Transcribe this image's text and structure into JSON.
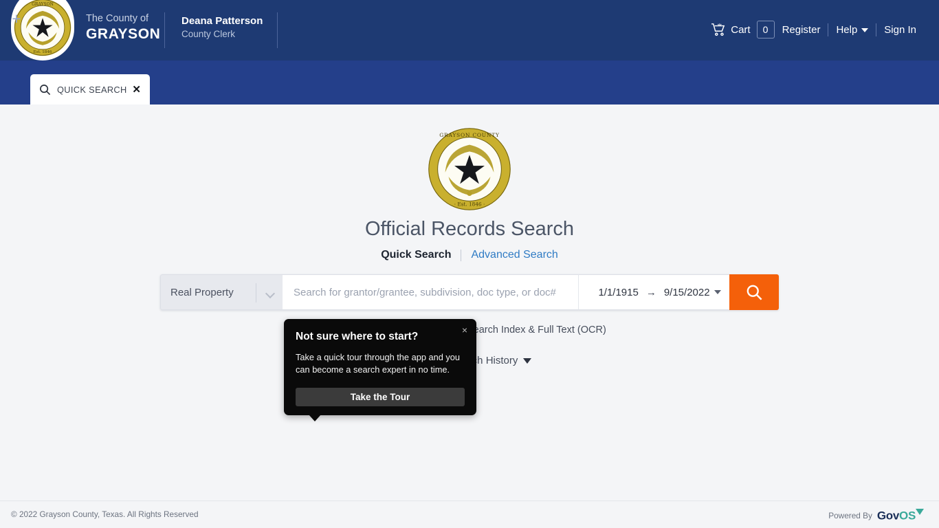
{
  "header": {
    "county_prefix": "The County of",
    "county_name": "GRAYSON",
    "clerk_name": "Deana Patterson",
    "clerk_title": "County Clerk",
    "nav": {
      "cart_label": "Cart",
      "cart_count": "0",
      "register_label": "Register",
      "help_label": "Help",
      "signin_label": "Sign In"
    },
    "colors": {
      "header_bg": "#1e3a73",
      "tabbar_bg": "#243f8a"
    }
  },
  "tabbar": {
    "add_tab_label": "+",
    "tabs": [
      {
        "label": "QUICK SEARCH",
        "icon": "search-icon",
        "close": "✕"
      }
    ]
  },
  "main": {
    "seal_alt": "Grayson County Texas Est. 1846",
    "title": "Official Records Search",
    "modes": {
      "quick_label": "Quick Search",
      "advanced_label": "Advanced Search"
    },
    "search": {
      "category_value": "Real Property",
      "query_value": "",
      "query_placeholder": "Search for grantor/grantee, subdivision, doc type, or doc#",
      "date_from": "1/1/1915",
      "date_to": "9/15/2022",
      "range_arrow": "→",
      "submit_icon": "search-icon",
      "submit_color": "#f4600a"
    },
    "options": {
      "ocr_label": "Search Index & Full Text (OCR)",
      "ocr_checked": false,
      "history_label": "Search History"
    },
    "popover": {
      "title": "Not sure where to start?",
      "body": "Take a quick tour through the app and you can become a search expert in no time.",
      "button_label": "Take the Tour",
      "close_label": "×"
    }
  },
  "footer": {
    "copyright": "© 2022 Grayson County, Texas. All Rights Reserved",
    "powered_by": "Powered By",
    "brand_gov": "Gov",
    "brand_os": "OS"
  }
}
